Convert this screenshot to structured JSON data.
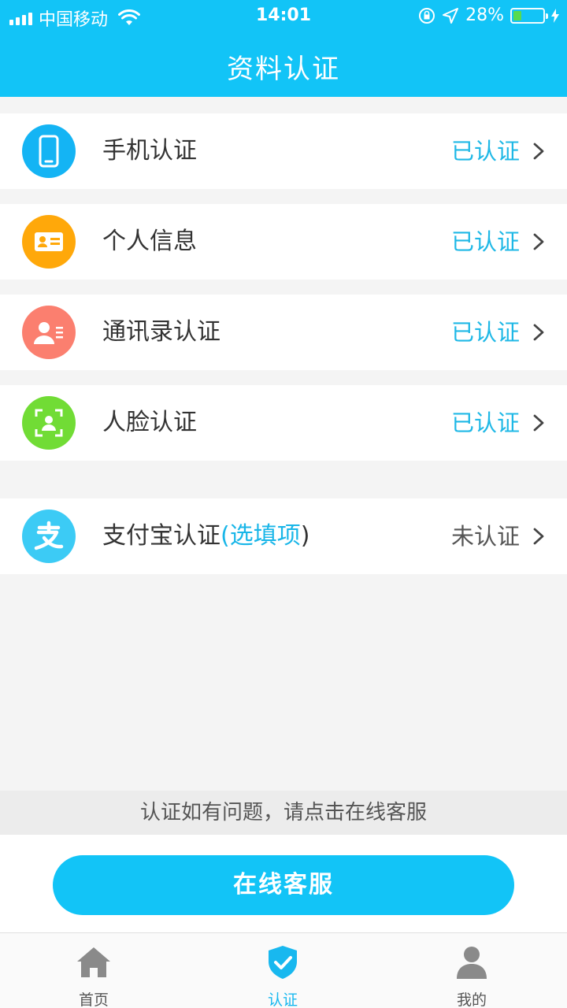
{
  "status_bar": {
    "carrier": "中国移动",
    "time": "14:01",
    "battery": "28%",
    "battery_level": 0.28
  },
  "header": {
    "title": "资料认证"
  },
  "items": [
    {
      "label": "手机认证",
      "status": "已认证",
      "icon": "phone-icon",
      "color": "#14b4f4"
    },
    {
      "label": "个人信息",
      "status": "已认证",
      "icon": "id-card-icon",
      "color": "#ffa80a"
    },
    {
      "label": "通讯录认证",
      "status": "已认证",
      "icon": "contacts-icon",
      "color": "#fb7f6f"
    },
    {
      "label": "人脸认证",
      "status": "已认证",
      "icon": "face-scan-icon",
      "color": "#71dc35"
    }
  ],
  "alipay": {
    "label_main": "支付宝认证",
    "label_paren_open": "(",
    "label_optional": "选填项",
    "label_paren_close": ")",
    "status": "未认证",
    "icon": "alipay-icon",
    "color": "#3ccbf5"
  },
  "help_text": "认证如有问题，请点击在线客服",
  "service_button": "在线客服",
  "tabs": [
    {
      "label": "首页",
      "icon": "home-icon",
      "active": false
    },
    {
      "label": "认证",
      "icon": "shield-check-icon",
      "active": true
    },
    {
      "label": "我的",
      "icon": "user-icon",
      "active": false
    }
  ],
  "colors": {
    "accent": "#12c4f7",
    "verified": "#1fb8e6",
    "unverified": "#555555"
  }
}
